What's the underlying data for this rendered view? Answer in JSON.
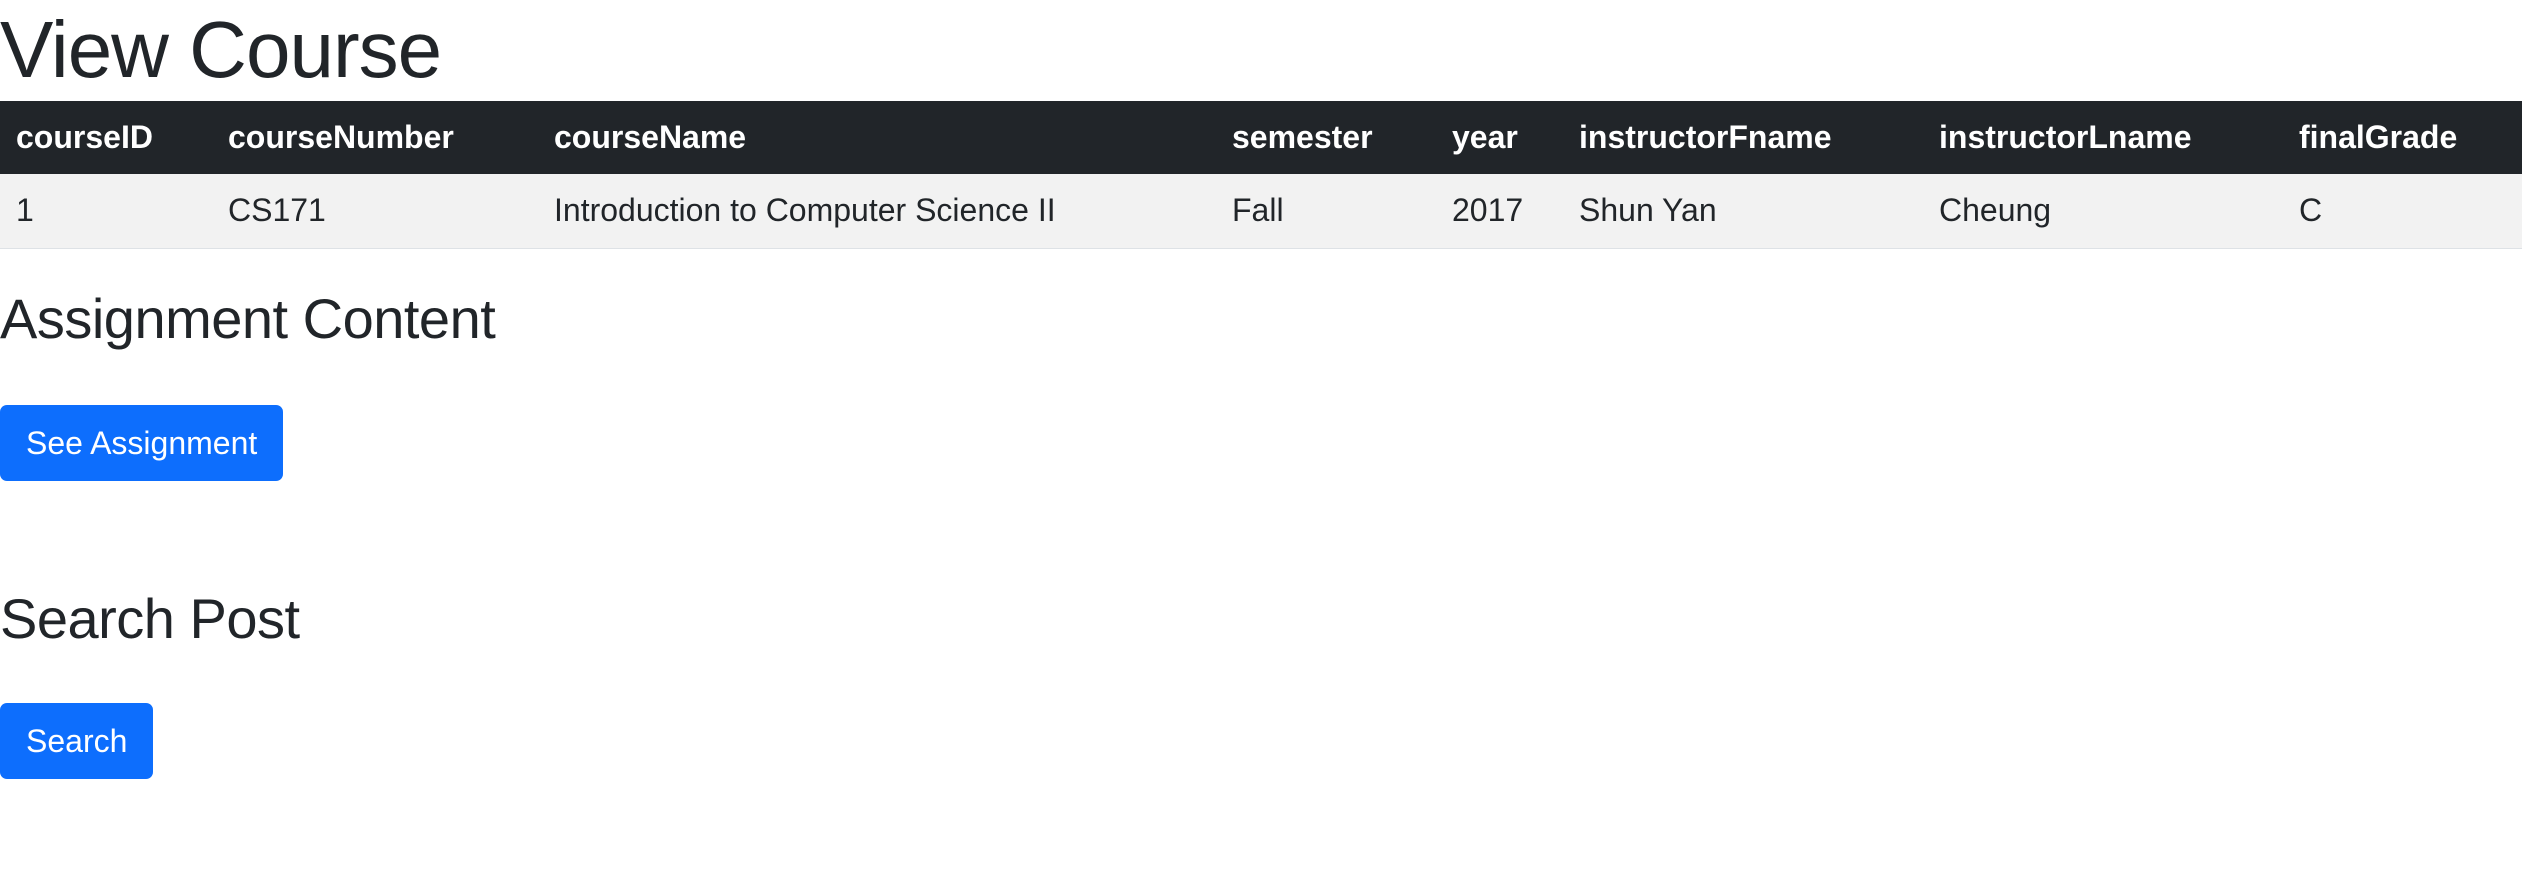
{
  "page": {
    "title": "View Course"
  },
  "table": {
    "headers": [
      "courseID",
      "courseNumber",
      "courseName",
      "semester",
      "year",
      "instructorFname",
      "instructorLname",
      "finalGrade"
    ],
    "rows": [
      [
        "1",
        "CS171",
        "Introduction to Computer Science II",
        "Fall",
        "2017",
        "Shun Yan",
        "Cheung",
        "C"
      ]
    ]
  },
  "assignment": {
    "heading": "Assignment Content",
    "button_label": "See Assignment"
  },
  "search": {
    "heading": "Search Post",
    "button_label": "Search"
  }
}
